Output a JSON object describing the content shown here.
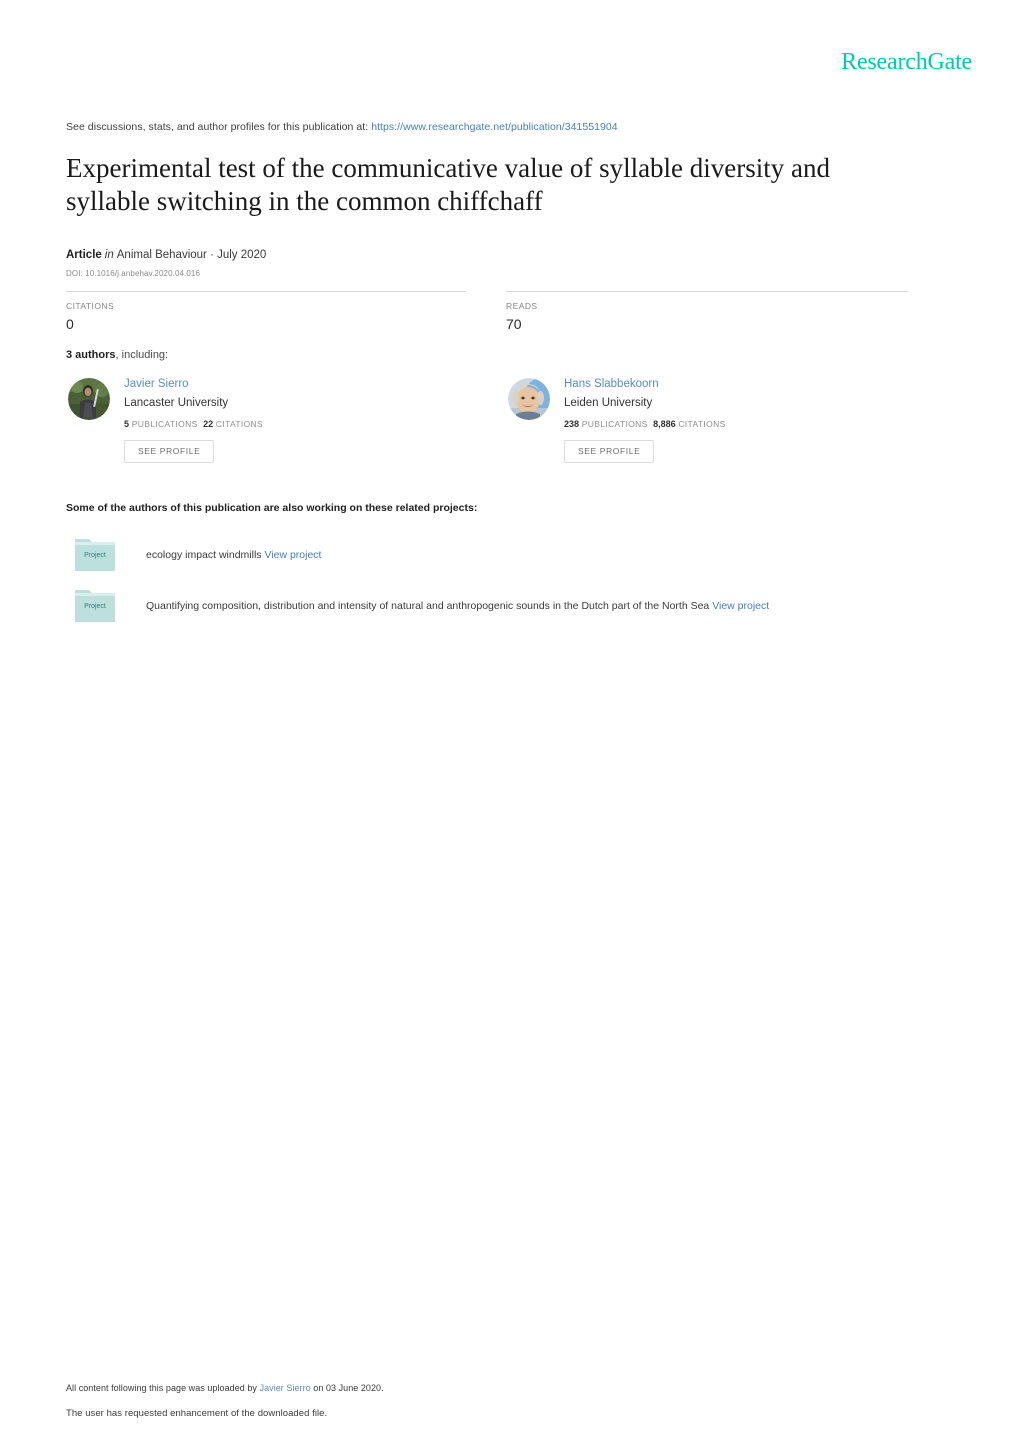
{
  "header": {
    "logo_text": "ResearchGate",
    "logo_color": "#00cbb0"
  },
  "discussions": {
    "prefix": "See discussions, stats, and author profiles for this publication at:",
    "url": "https://www.researchgate.net/publication/341551904"
  },
  "publication": {
    "title": "Experimental test of the communicative value of syllable diversity and syllable switching in the common chiffchaff",
    "type_label": "Article",
    "in_label": "in",
    "journal_and_date": "Animal Behaviour · July 2020",
    "doi": "DOI: 10.1016/j.anbehav.2020.04.016"
  },
  "stats": {
    "citations_label": "CITATIONS",
    "citations_value": "0",
    "reads_label": "READS",
    "reads_value": "70"
  },
  "authors_section": {
    "count_label": "3 authors",
    "count_suffix": ", including:",
    "authors": [
      {
        "name": "Javier Sierro",
        "affiliation": "Lancaster University",
        "publications_count": "5",
        "publications_label": "PUBLICATIONS",
        "citations_count": "22",
        "citations_label": "CITATIONS",
        "profile_button": "SEE PROFILE"
      },
      {
        "name": "Hans Slabbekoorn",
        "affiliation": "Leiden University",
        "publications_count": "238",
        "publications_label": "PUBLICATIONS",
        "citations_count": "8,886",
        "citations_label": "CITATIONS",
        "profile_button": "SEE PROFILE"
      }
    ]
  },
  "projects_section": {
    "heading": "Some of the authors of this publication are also working on these related projects:",
    "icon_label": "Project",
    "projects": [
      {
        "title": "ecology impact windmills",
        "link_text": "View project"
      },
      {
        "title": "Quantifying composition, distribution and intensity of natural and anthropogenic sounds in the Dutch part of the North Sea",
        "link_text": "View project"
      }
    ]
  },
  "footer": {
    "upload_prefix": "All content following this page was uploaded by",
    "upload_author": "Javier Sierro",
    "upload_suffix": "on 03 June 2020.",
    "enhancement_note": "The user has requested enhancement of the downloaded file."
  }
}
